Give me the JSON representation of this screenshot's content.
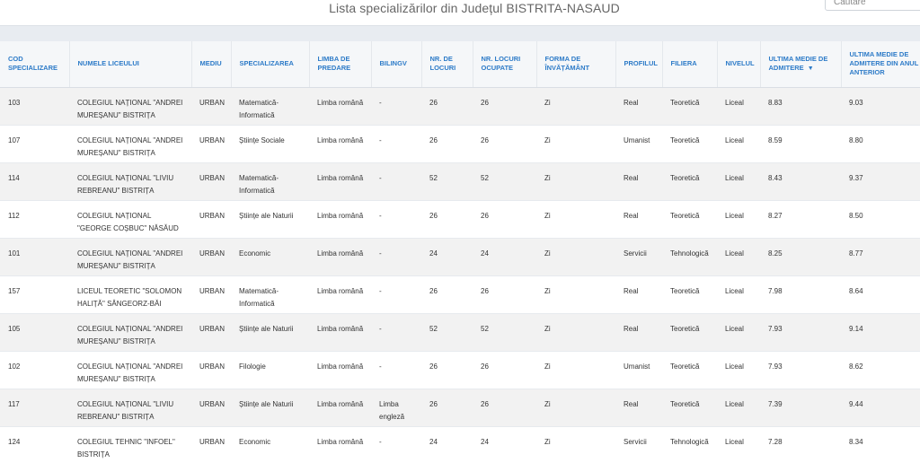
{
  "page": {
    "title": "Lista specializărilor din Județul BISTRITA-NASAUD",
    "search_placeholder": "Căutare"
  },
  "table": {
    "columns": [
      {
        "key": "cod",
        "label": "COD SPECIALIZARE"
      },
      {
        "key": "liceu",
        "label": "NUMELE LICEULUI"
      },
      {
        "key": "mediu",
        "label": "MEDIU"
      },
      {
        "key": "specializarea",
        "label": "SPECIALIZAREA"
      },
      {
        "key": "limba",
        "label": "LIMBA DE PREDARE"
      },
      {
        "key": "bilingv",
        "label": "BILINGV"
      },
      {
        "key": "locuri",
        "label": "NR. DE LOCURI"
      },
      {
        "key": "ocupate",
        "label": "NR. LOCURI OCUPATE"
      },
      {
        "key": "forma",
        "label": "FORMA DE ÎNVĂȚĂMÂNT"
      },
      {
        "key": "profilul",
        "label": "PROFILUL"
      },
      {
        "key": "filiera",
        "label": "FILIERA"
      },
      {
        "key": "nivelul",
        "label": "NIVELUL"
      },
      {
        "key": "medie",
        "label": "ULTIMA MEDIE DE ADMITERE",
        "sort_indicator": "▼"
      },
      {
        "key": "medie_anterior",
        "label": "ULTIMA MEDIE DE ADMITERE DIN ANUL ANTERIOR"
      }
    ],
    "rows": [
      {
        "cod": "103",
        "liceu": "COLEGIUL NAȚIONAL \"ANDREI MUREȘANU\" BISTRIȚA",
        "mediu": "URBAN",
        "specializarea": "Matematică-Informatică",
        "limba": "Limba română",
        "bilingv": "-",
        "locuri": "26",
        "ocupate": "26",
        "forma": "Zi",
        "profilul": "Real",
        "filiera": "Teoretică",
        "nivelul": "Liceal",
        "medie": "8.83",
        "medie_anterior": "9.03"
      },
      {
        "cod": "107",
        "liceu": "COLEGIUL NAȚIONAL \"ANDREI MUREȘANU\" BISTRIȚA",
        "mediu": "URBAN",
        "specializarea": "Științe Sociale",
        "limba": "Limba română",
        "bilingv": "-",
        "locuri": "26",
        "ocupate": "26",
        "forma": "Zi",
        "profilul": "Umanist",
        "filiera": "Teoretică",
        "nivelul": "Liceal",
        "medie": "8.59",
        "medie_anterior": "8.80"
      },
      {
        "cod": "114",
        "liceu": "COLEGIUL NAȚIONAL \"LIVIU REBREANU\" BISTRIȚA",
        "mediu": "URBAN",
        "specializarea": "Matematică-Informatică",
        "limba": "Limba română",
        "bilingv": "-",
        "locuri": "52",
        "ocupate": "52",
        "forma": "Zi",
        "profilul": "Real",
        "filiera": "Teoretică",
        "nivelul": "Liceal",
        "medie": "8.43",
        "medie_anterior": "9.37"
      },
      {
        "cod": "112",
        "liceu": "COLEGIUL NAȚIONAL \"GEORGE COȘBUC\" NĂSĂUD",
        "mediu": "URBAN",
        "specializarea": "Științe ale Naturii",
        "limba": "Limba română",
        "bilingv": "-",
        "locuri": "26",
        "ocupate": "26",
        "forma": "Zi",
        "profilul": "Real",
        "filiera": "Teoretică",
        "nivelul": "Liceal",
        "medie": "8.27",
        "medie_anterior": "8.50"
      },
      {
        "cod": "101",
        "liceu": "COLEGIUL NAȚIONAL \"ANDREI MUREȘANU\" BISTRIȚA",
        "mediu": "URBAN",
        "specializarea": "Economic",
        "limba": "Limba română",
        "bilingv": "-",
        "locuri": "24",
        "ocupate": "24",
        "forma": "Zi",
        "profilul": "Servicii",
        "filiera": "Tehnologică",
        "nivelul": "Liceal",
        "medie": "8.25",
        "medie_anterior": "8.77"
      },
      {
        "cod": "157",
        "liceu": "LICEUL TEORETIC \"SOLOMON HALIȚĂ\" SÂNGEORZ-BĂI",
        "mediu": "URBAN",
        "specializarea": "Matematică-Informatică",
        "limba": "Limba română",
        "bilingv": "-",
        "locuri": "26",
        "ocupate": "26",
        "forma": "Zi",
        "profilul": "Real",
        "filiera": "Teoretică",
        "nivelul": "Liceal",
        "medie": "7.98",
        "medie_anterior": "8.64"
      },
      {
        "cod": "105",
        "liceu": "COLEGIUL NAȚIONAL \"ANDREI MUREȘANU\" BISTRIȚA",
        "mediu": "URBAN",
        "specializarea": "Științe ale Naturii",
        "limba": "Limba română",
        "bilingv": "-",
        "locuri": "52",
        "ocupate": "52",
        "forma": "Zi",
        "profilul": "Real",
        "filiera": "Teoretică",
        "nivelul": "Liceal",
        "medie": "7.93",
        "medie_anterior": "9.14"
      },
      {
        "cod": "102",
        "liceu": "COLEGIUL NAȚIONAL \"ANDREI MUREȘANU\" BISTRIȚA",
        "mediu": "URBAN",
        "specializarea": "Filologie",
        "limba": "Limba română",
        "bilingv": "-",
        "locuri": "26",
        "ocupate": "26",
        "forma": "Zi",
        "profilul": "Umanist",
        "filiera": "Teoretică",
        "nivelul": "Liceal",
        "medie": "7.93",
        "medie_anterior": "8.62"
      },
      {
        "cod": "117",
        "liceu": "COLEGIUL NAȚIONAL \"LIVIU REBREANU\" BISTRIȚA",
        "mediu": "URBAN",
        "specializarea": "Științe ale Naturii",
        "limba": "Limba română",
        "bilingv": "Limba engleză",
        "locuri": "26",
        "ocupate": "26",
        "forma": "Zi",
        "profilul": "Real",
        "filiera": "Teoretică",
        "nivelul": "Liceal",
        "medie": "7.39",
        "medie_anterior": "9.44"
      },
      {
        "cod": "124",
        "liceu": "COLEGIUL TEHNIC \"INFOEL\" BISTRIȚA",
        "mediu": "URBAN",
        "specializarea": "Economic",
        "limba": "Limba română",
        "bilingv": "-",
        "locuri": "24",
        "ocupate": "24",
        "forma": "Zi",
        "profilul": "Servicii",
        "filiera": "Tehnologică",
        "nivelul": "Liceal",
        "medie": "7.28",
        "medie_anterior": "8.34"
      }
    ]
  },
  "colors": {
    "header_text": "#2d7bc8",
    "row_alt_bg": "#f2f2f2",
    "strip_bg": "#e8ecf1"
  }
}
